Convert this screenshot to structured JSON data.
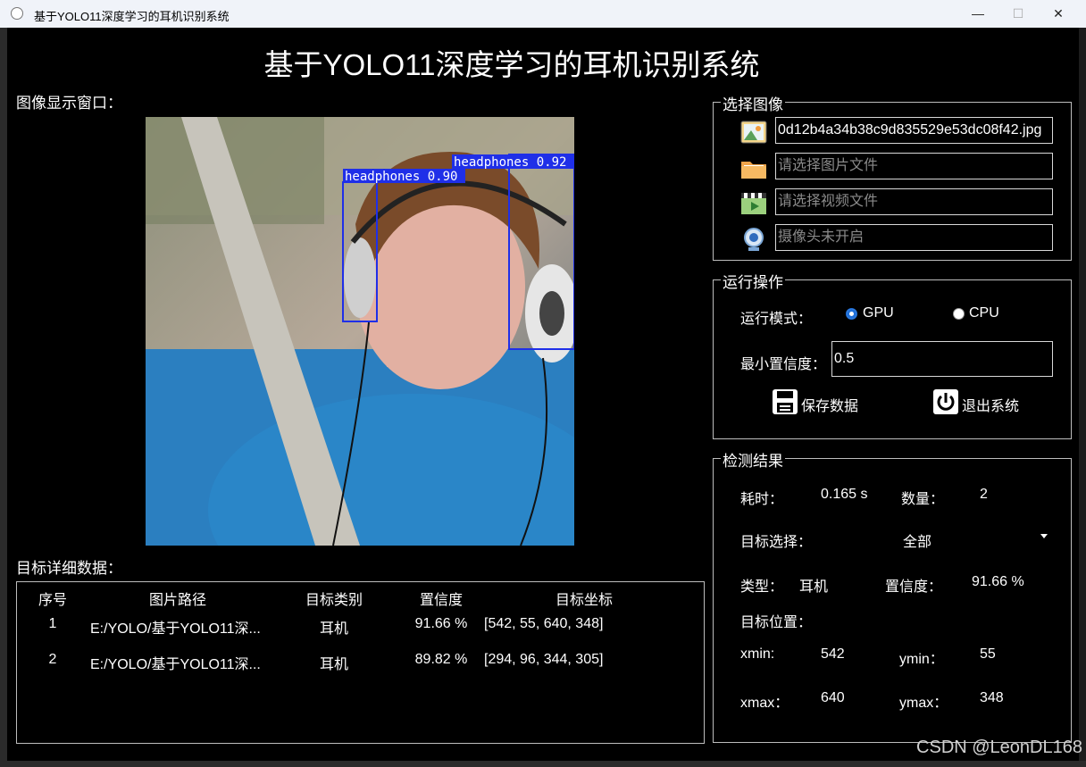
{
  "window": {
    "title": "基于YOLO11深度学习的耳机识别系统",
    "minimize": "—",
    "maximize": "☐",
    "close": "✕"
  },
  "app_title": "基于YOLO11深度学习的耳机识别系统",
  "image_label": "图像显示窗口：",
  "detections_image": [
    {
      "label": "headphones 0.92"
    },
    {
      "label": "headphones 0.90"
    }
  ],
  "select_group": {
    "title": "选择图像",
    "image_file": "0d12b4a34b38c9d835529e53dc08f42.jpg",
    "folder_placeholder": "请选择图片文件",
    "video_placeholder": "请选择视频文件",
    "camera_placeholder": "摄像头未开启",
    "icons": [
      "image-icon",
      "folder-icon",
      "video-icon",
      "webcam-icon"
    ]
  },
  "run_group": {
    "title": "运行操作",
    "mode_label": "运行模式：",
    "gpu_label": "GPU",
    "cpu_label": "CPU",
    "selected_mode": "GPU",
    "conf_label": "最小置信度：",
    "conf_value": "0.5",
    "save_label": "保存数据",
    "exit_label": "退出系统"
  },
  "result_group": {
    "title": "检测结果",
    "time_label": "耗时：",
    "time_value": "0.165 s",
    "count_label": "数量：",
    "count_value": "2",
    "target_label": "目标选择：",
    "target_value": "全部",
    "type_label": "类型：",
    "type_value": "耳机",
    "conf_label": "置信度：",
    "conf_value": "91.66 %",
    "pos_label": "目标位置：",
    "xmin_label": "xmin:",
    "xmin_value": "542",
    "ymin_label": "ymin：",
    "ymin_value": "55",
    "xmax_label": "xmax：",
    "xmax_value": "640",
    "ymax_label": "ymax：",
    "ymax_value": "348"
  },
  "table": {
    "title": "目标详细数据：",
    "headers": [
      "序号",
      "图片路径",
      "目标类别",
      "置信度",
      "目标坐标"
    ],
    "rows": [
      [
        "1",
        "E:/YOLO/基于YOLO11深...",
        "耳机",
        "91.66 %",
        "[542, 55, 640, 348]"
      ],
      [
        "2",
        "E:/YOLO/基于YOLO11深...",
        "耳机",
        "89.82 %",
        "[294, 96, 344, 305]"
      ]
    ]
  },
  "watermark": "CSDN @LeonDL168",
  "colors": {
    "background": "#000000",
    "accent": "#1e6fd9",
    "bbox": "#1f2fe8"
  }
}
